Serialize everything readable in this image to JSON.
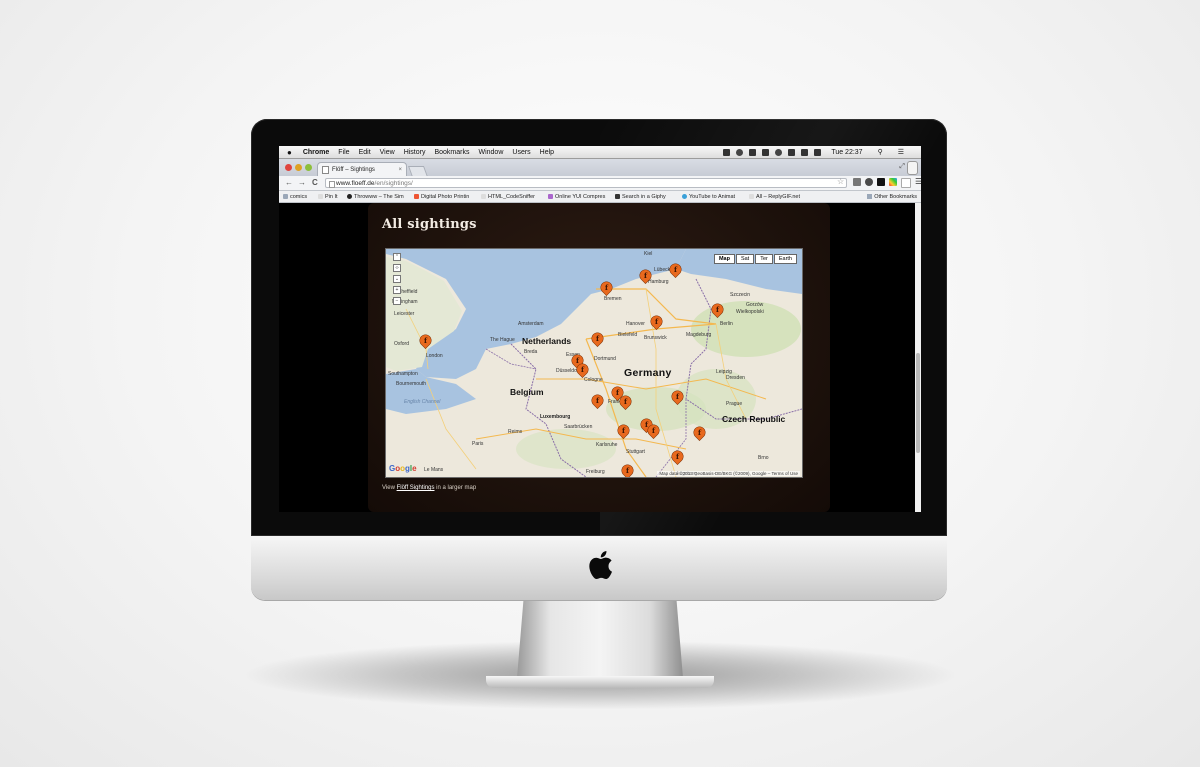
{
  "menubar": {
    "app_name": "Chrome",
    "items": [
      "File",
      "Edit",
      "View",
      "History",
      "Bookmarks",
      "Window",
      "Users",
      "Help"
    ],
    "clock": "Tue 22:37"
  },
  "tab": {
    "title": "Flöff – Sightings",
    "close": "×"
  },
  "toolbar": {
    "url_domain": "www.floeff.de",
    "url_path": "/en/sightings/",
    "back": "←",
    "forward": "→",
    "reload": "C",
    "star": "☆"
  },
  "bookmarks": {
    "items": [
      "comics",
      "Pin It",
      "Throwww – The Sim",
      "Digital Photo Printin",
      "HTML_CodeSniffer",
      "Online YUI Compres",
      "Search in a Giphy",
      "YouTube to Animat",
      "All – ReplyGIF.net"
    ],
    "other": "Other Bookmarks"
  },
  "page": {
    "title": "All sightings",
    "view_prefix": "View",
    "view_link": "Flöff Sightings",
    "view_suffix": "in a larger map"
  },
  "map": {
    "types": [
      "Map",
      "Sat",
      "Ter",
      "Earth"
    ],
    "active_type": "Map",
    "zoom_controls": [
      "+",
      "−"
    ],
    "countries": [
      "Netherlands",
      "Belgium",
      "Germany",
      "Czech Republic",
      "Luxembourg"
    ],
    "cities": [
      "Kiel",
      "Lübeck",
      "Hamburg",
      "Bremen",
      "Szczecin",
      "Gorzów",
      "Wielkopolski",
      "Berlin",
      "Hanover",
      "Magdeburg",
      "Amsterdam",
      "The Hague",
      "Brunswick",
      "Bielefeld",
      "Breda",
      "Dortmund",
      "Essen",
      "Düsseldorf",
      "Cologne",
      "Leipzig",
      "Dresden",
      "Frankfurt",
      "Prague",
      "Stuttgart",
      "Freiburg",
      "Paris",
      "Reims",
      "Le Mans",
      "London",
      "Oxford",
      "Nottingham",
      "Leicester",
      "Sheffield",
      "Southampton",
      "Bournemouth",
      "Saarbrücken",
      "Karlsruhe",
      "Augsburg",
      "Brno"
    ],
    "seas": [
      "English Channel"
    ],
    "logo_letters": [
      "G",
      "o",
      "o",
      "g",
      "l",
      "e"
    ],
    "attribution": "Map data ©2013 GeoBasis-DE/BKG (©2009), Google – Terms of Use",
    "pin_glyph": "f",
    "pin_count": 17
  },
  "colors": {
    "pin": "#e8691e",
    "panel": "#1e120c",
    "water": "#a8c3e0",
    "land": "#ede8dc"
  }
}
